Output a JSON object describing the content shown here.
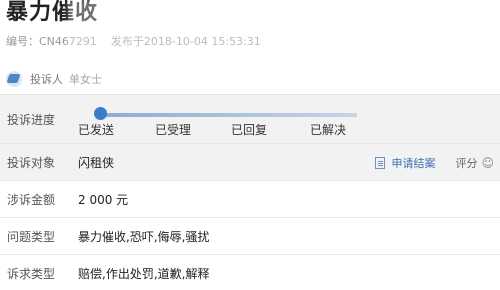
{
  "page": {
    "title": "暴力催收",
    "meta_id_label": "编号：",
    "meta_id": "CN467291",
    "meta_date_label": "发布于",
    "meta_date": "2018-10-04 15:53:31"
  },
  "complainant": {
    "label": "投诉人",
    "name": "单女士"
  },
  "rows": {
    "progress_key": "投诉进度",
    "steps": [
      "已发送",
      "已受理",
      "已回复",
      "已解决"
    ],
    "target_key": "投诉对象",
    "target_value": "闪租侠",
    "apply_label": "申请结案",
    "rate_label": "评分",
    "amount_key": "涉诉金额",
    "amount_value": "2 000 元",
    "issue_key": "问题类型",
    "issue_value": "暴力催收,恐吓,侮辱,骚扰",
    "demand_key": "诉求类型",
    "demand_value": "赔偿,作出处罚,道歉,解释"
  },
  "colors": {
    "accent": "#3b6fb5",
    "row_shade": "#f2f2f2"
  }
}
